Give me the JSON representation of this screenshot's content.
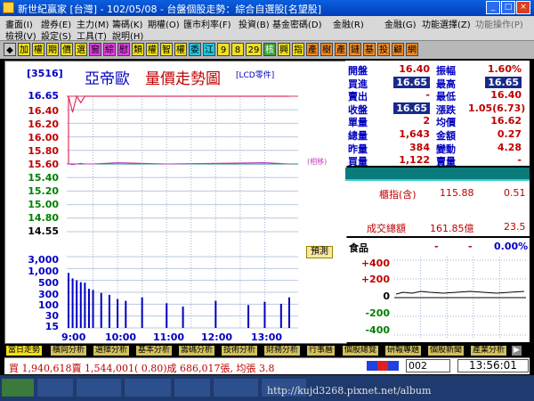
{
  "window": {
    "title": "新世紀贏家 [台灣] - 102/05/08 - 台盤個股走勢：綜合自選股[名望股]",
    "controls": [
      "_",
      "□",
      "×"
    ]
  },
  "menu": {
    "row1": [
      "畫面(I)",
      "證券(E)",
      "主力(M)",
      "籌碼(K)",
      "期權(O)",
      "匯市利率(F)",
      "投資(B)",
      "基金密碼(D)",
      "金融(R)",
      "金融(G)",
      "功能選擇(Z)",
      "功能操作(P)"
    ],
    "row2": [
      "檢視(V)",
      "設定(S)",
      "工具(T)",
      "說明(H)"
    ]
  },
  "toolbar": {
    "buttons": [
      "◆",
      "加",
      "權",
      "期",
      "價",
      "選",
      "窗",
      "綜",
      "慰",
      "類",
      "權",
      "智",
      "權",
      "委",
      "江",
      "9",
      "8",
      "29",
      "核",
      "興",
      "指",
      "產",
      "樹",
      "產",
      "鏈",
      "基",
      "投",
      "顧",
      "網"
    ]
  },
  "chart": {
    "code": "[3516]",
    "name": "亞帝歐",
    "title": "量價走勢圖",
    "subtitle": "[LCD零件]",
    "ref_note": "(相移)",
    "forecast_label": "預測",
    "price_labels": [
      "16.65",
      "16.40",
      "16.20",
      "16.00",
      "15.80",
      "15.60",
      "15.40",
      "15.20",
      "15.00",
      "14.80",
      "14.55"
    ],
    "volume_labels": [
      "3,000",
      "1,000",
      "500",
      "300",
      "100",
      "30",
      "15",
      "張"
    ],
    "time_labels": [
      "9:00",
      "10:00",
      "11:00",
      "12:00",
      "13:00"
    ]
  },
  "chart_data": {
    "type": "line",
    "price_axis": {
      "ylim": [
        14.55,
        16.65
      ],
      "ref": 15.6,
      "limit_up": 16.65
    },
    "x": [
      "9:00",
      "9:05",
      "9:10",
      "9:15",
      "9:20",
      "9:30",
      "10:00",
      "11:00",
      "12:00",
      "13:00",
      "13:30"
    ],
    "price": [
      16.65,
      16.4,
      16.65,
      16.55,
      16.65,
      16.65,
      16.65,
      16.65,
      16.65,
      16.65,
      16.65
    ],
    "avg_price": [
      15.6,
      15.59,
      15.6,
      15.61,
      15.6,
      15.6,
      15.62,
      15.6,
      15.61,
      15.62,
      15.6
    ],
    "volume_x": [
      "9:00",
      "9:05",
      "9:10",
      "9:15",
      "9:20",
      "9:25",
      "9:30",
      "9:40",
      "9:50",
      "10:00",
      "10:10",
      "10:30",
      "11:00",
      "11:20",
      "12:00",
      "12:40",
      "13:00",
      "13:20",
      "13:30"
    ],
    "volume": [
      480,
      260,
      210,
      170,
      160,
      80,
      70,
      50,
      40,
      25,
      20,
      30,
      15,
      10,
      20,
      12,
      18,
      14,
      30
    ]
  },
  "quote": {
    "rows": [
      {
        "k1": "開盤",
        "v1": "16.40",
        "k2": "振幅",
        "v2": "1.60%",
        "hl1": false,
        "hl2": false
      },
      {
        "k1": "買進",
        "v1": "16.65",
        "k2": "最高",
        "v2": "16.65",
        "hl1": true,
        "hl2": true
      },
      {
        "k1": "賣出",
        "v1": "-",
        "k2": "最低",
        "v2": "16.40",
        "hl1": false,
        "hl2": false
      },
      {
        "k1": "收盤",
        "v1": "16.65",
        "k2": "漲跌",
        "v2": "1.05(6.73)",
        "hl1": true,
        "hl2": false
      },
      {
        "k1": "單量",
        "v1": "2",
        "k2": "均價",
        "v2": "16.62",
        "hl1": false,
        "hl2": false
      },
      {
        "k1": "總量",
        "v1": "1,643",
        "k2": "金額",
        "v2": "0.27",
        "hl1": false,
        "hl2": false
      },
      {
        "k1": "昨量",
        "v1": "384",
        "k2": "變動",
        "v2": "4.28",
        "hl1": false,
        "hl2": false
      },
      {
        "k1": "買量",
        "v1": "1,122",
        "k2": "賣量",
        "v2": "-",
        "hl1": false,
        "hl2": false
      }
    ]
  },
  "index": {
    "label": "櫃指(含)",
    "value": "115.88",
    "change": "0.51",
    "amount_label": "成交總額",
    "amount_value": "161.85億",
    "amount_change": "23.5"
  },
  "sector": {
    "label": "食品",
    "val1": "-",
    "val2": "-",
    "pct": "0.00%",
    "axis": [
      "+400",
      "+200",
      "0",
      "-200",
      "-400"
    ]
  },
  "tabs": [
    "當日走勢",
    "橫向分析",
    "選擇分析",
    "基本分析",
    "籌碼分析",
    "技術分析",
    "財務分析",
    "行事曆",
    "個股總覽",
    "研報專題",
    "個股新聞",
    "產業分析"
  ],
  "status": {
    "text": "買 1,940,618賣 1,544,001( 0.80)成 686,017張, 均張 3.8",
    "code": "002",
    "time": "13:56:01"
  },
  "taskbar": {
    "items": [
      "",
      "",
      "",
      "",
      "",
      "",
      ""
    ],
    "watermark": "http://kujd3268.pixnet.net/album"
  },
  "colors": {
    "up": "#c00000",
    "down": "#008000",
    "accent": "#0000c0",
    "limit": "#e03060",
    "avg": "#c040c0"
  }
}
